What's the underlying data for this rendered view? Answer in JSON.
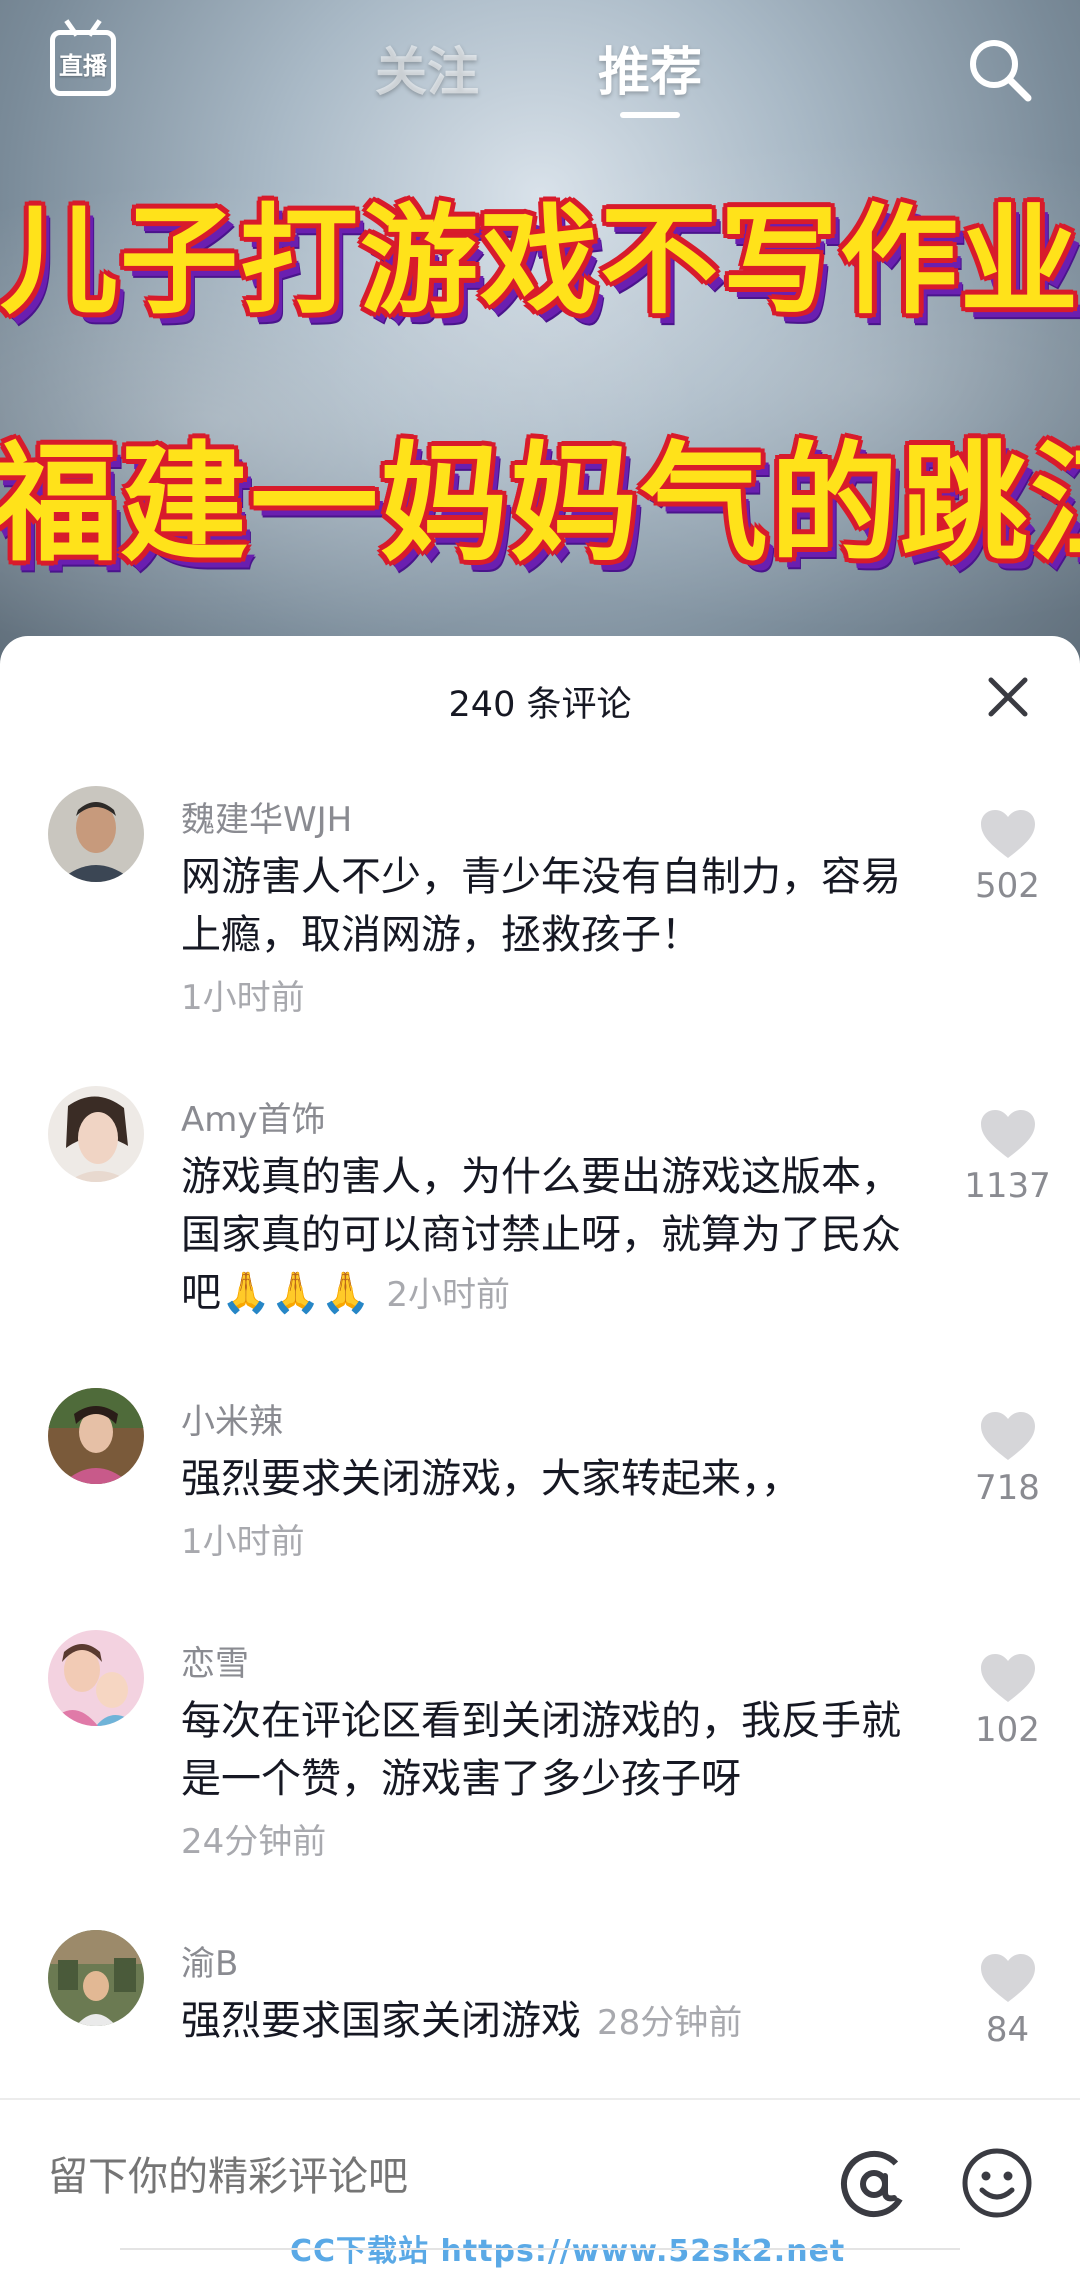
{
  "nav": {
    "live_label": "直播",
    "tab_follow": "关注",
    "tab_recommend": "推荐"
  },
  "video": {
    "banner_line1": "儿子打游戏不写作业",
    "banner_line2": "福建一妈妈气的跳江了"
  },
  "sheet": {
    "title": "240 条评论"
  },
  "comments": [
    {
      "user": "魏建华WJH",
      "text": "网游害人不少，青少年没有自制力，容易上瘾，取消网游，拯救孩子！",
      "time": "1小时前",
      "likes": "502"
    },
    {
      "user": "Amy首饰",
      "text": "游戏真的害人，为什么要出游戏这版本，国家真的可以商讨禁止呀，就算为了民众吧🙏🙏🙏",
      "time": "2小时前",
      "likes": "1137"
    },
    {
      "user": "小米辣",
      "text": "强烈要求关闭游戏，大家转起来，，",
      "time": "1小时前",
      "likes": "718"
    },
    {
      "user": "恋雪",
      "text": "每次在评论区看到关闭游戏的，我反手就是一个赞，游戏害了多少孩子呀",
      "time": "24分钟前",
      "likes": "102"
    },
    {
      "user": "渝B",
      "text": "强烈要求国家关闭游戏",
      "time": "28分钟前",
      "likes": "84"
    }
  ],
  "input": {
    "placeholder": "留下你的精彩评论吧"
  },
  "watermark": "CC下载站  https://www.52sk2.net",
  "colors": {
    "banner_fill": "#ffe21a",
    "banner_outline": "#d81b2b",
    "banner_shadow": "#6a1fb0"
  }
}
